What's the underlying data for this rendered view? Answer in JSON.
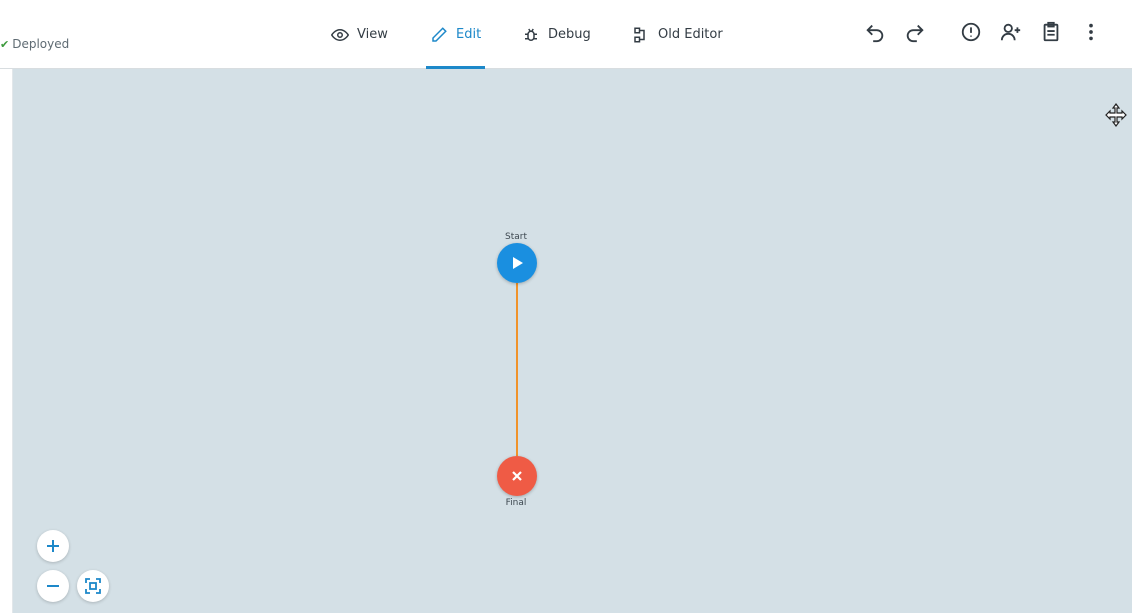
{
  "status": {
    "label": "Deployed"
  },
  "tabs": [
    {
      "label": "View",
      "icon": "eye-icon",
      "active": false
    },
    {
      "label": "Edit",
      "icon": "pencil-icon",
      "active": true
    },
    {
      "label": "Debug",
      "icon": "bug-icon",
      "active": false
    },
    {
      "label": "Old Editor",
      "icon": "old-editor-icon",
      "active": false
    }
  ],
  "toolbar": [
    "undo-icon",
    "redo-icon",
    "alert-icon",
    "add-user-icon",
    "clipboard-icon",
    "more-vertical-icon"
  ],
  "flow": {
    "start": {
      "label": "Start",
      "color": "#1a8fe0"
    },
    "final": {
      "label": "Final",
      "color": "#ef5b45"
    },
    "connector_color": "#f0932b"
  },
  "colors": {
    "accent": "#1d88c9",
    "canvas": "#d4e0e6"
  }
}
